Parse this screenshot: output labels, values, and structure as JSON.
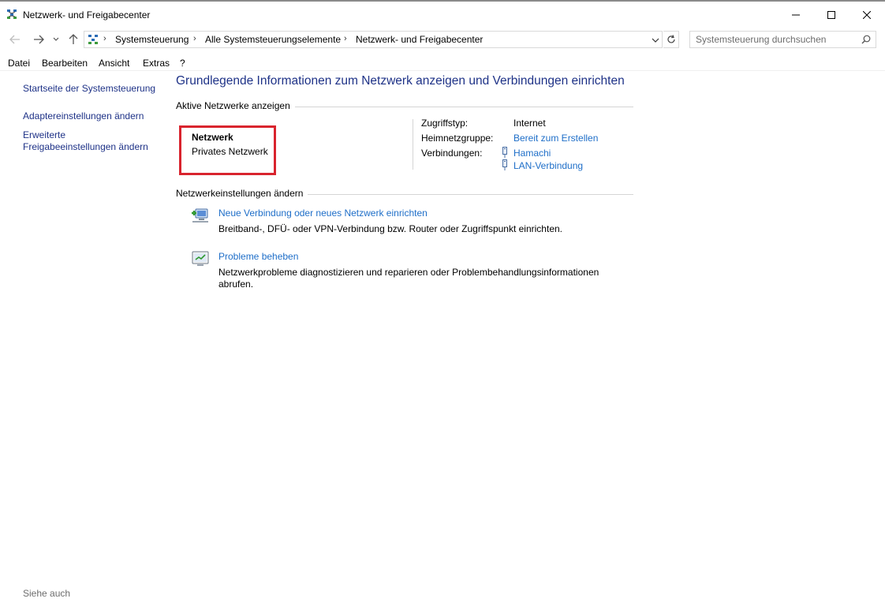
{
  "window": {
    "title": "Netzwerk- und Freigabecenter"
  },
  "address_bar": {
    "breadcrumbs": [
      "Systemsteuerung",
      "Alle Systemsteuerungselemente",
      "Netzwerk- und Freigabecenter"
    ]
  },
  "search": {
    "placeholder": "Systemsteuerung durchsuchen"
  },
  "menu": [
    "Datei",
    "Bearbeiten",
    "Ansicht",
    "Extras",
    "?"
  ],
  "sidebar": {
    "links": [
      "Startseite der Systemsteuerung",
      "Adaptereinstellungen ändern",
      "Erweiterte",
      "Freigabeeinstellungen ändern"
    ],
    "see_also": "Siehe auch"
  },
  "main": {
    "heading": "Grundlegende Informationen zum Netzwerk anzeigen und Verbindungen einrichten",
    "active_section": "Aktive Netzwerke anzeigen",
    "network": {
      "name": "Netzwerk",
      "type": "Privates Netzwerk"
    },
    "properties": {
      "access_label": "Zugriffstyp:",
      "access_value": "Internet",
      "homegroup_label": "Heimnetzgruppe:",
      "homegroup_value": "Bereit zum Erstellen",
      "connections_label": "Verbindungen:",
      "connections": [
        "Hamachi",
        "LAN-Verbindung"
      ]
    },
    "settings_section": "Netzwerkeinstellungen ändern",
    "tasks": [
      {
        "link": "Neue Verbindung oder neues Netzwerk einrichten",
        "description": "Breitband-, DFÜ- oder VPN-Verbindung bzw. Router oder Zugriffspunkt einrichten."
      },
      {
        "link": "Probleme beheben",
        "description_line1": "Netzwerkprobleme diagnostizieren und reparieren oder Problembehandlungsinformationen",
        "description_line2": "abrufen."
      }
    ]
  },
  "colors": {
    "link": "#1e6ec8",
    "heading": "#1e3287",
    "highlight": "#d9242e"
  }
}
